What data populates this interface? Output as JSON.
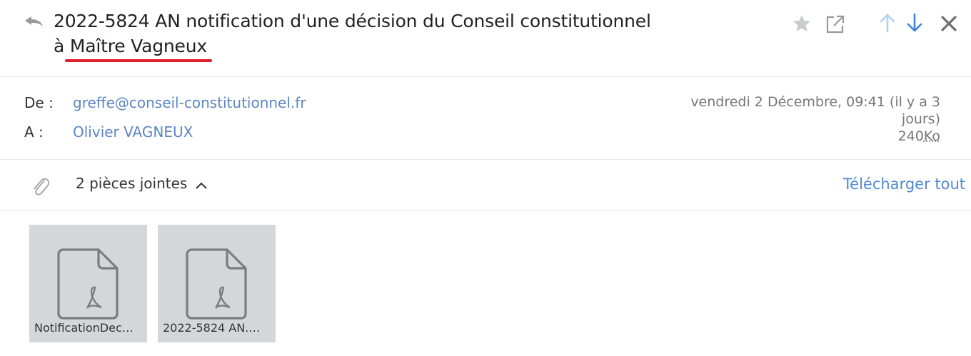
{
  "message": {
    "subject_line1": "2022-5824 AN notification d'une décision du Conseil constitutionnel",
    "subject_line2": "à Maître Vagneux",
    "from_label": "De :",
    "from_value": "greffe@conseil-constitutionnel.fr",
    "to_label": "A :",
    "to_value": "Olivier VAGNEUX",
    "date_line1": "vendredi 2 Décembre, 09:41 (il y a 3",
    "date_line2": "jours)",
    "size_number": "240",
    "size_unit": "Ko"
  },
  "toolbar": {
    "icons": [
      "reply-icon",
      "star-icon",
      "popout-icon",
      "arrow-up-icon",
      "arrow-down-icon",
      "close-icon"
    ]
  },
  "attachments": {
    "count_label": "2 pièces jointes",
    "download_all": "Télécharger tout",
    "items": [
      {
        "name": "NotificationDec…",
        "icon": "pdf-file-icon"
      },
      {
        "name": "2022-5824 AN.…",
        "icon": "pdf-file-icon"
      }
    ]
  },
  "colors": {
    "link": "#5b86c4",
    "accent_blue": "#4f8bd1",
    "highlight_red": "#e01e2b",
    "tile_bg": "#d4d7da"
  }
}
